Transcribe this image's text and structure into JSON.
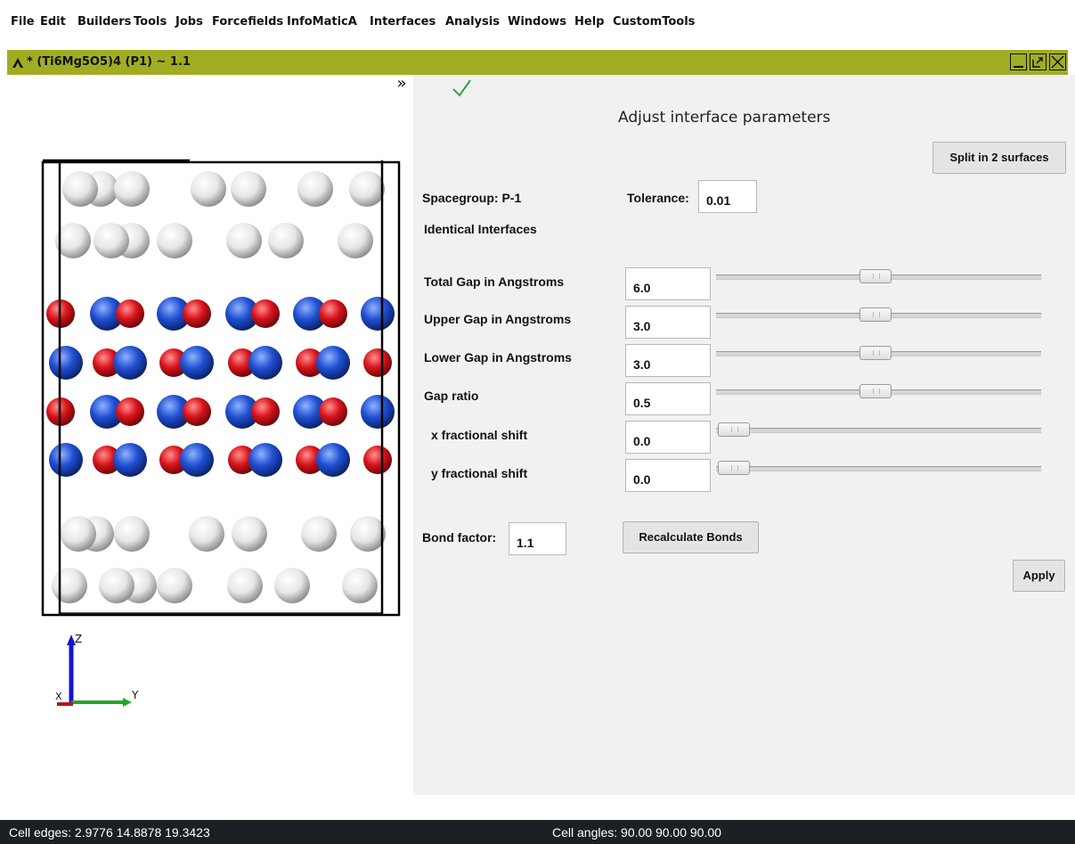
{
  "menu": [
    "File",
    "Edit",
    "Builders",
    "Tools",
    "Jobs",
    "Forcefields",
    "InfoMaticA",
    "Interfaces",
    "Analysis",
    "Windows",
    "Help",
    "CustomTools"
  ],
  "window": {
    "title": "* (Ti6Mg5O5)4  (P1) ~ 1.1",
    "icon": "app-logo-icon",
    "titlebar_color": "#a0ad23",
    "buttons": [
      "minimize-icon",
      "restore-icon",
      "close-icon"
    ]
  },
  "viewer": {
    "collapse_glyph": "»",
    "axes": {
      "z": "Z",
      "y": "Y",
      "x": "X"
    },
    "atom_colors": {
      "white": "#e6e6e6",
      "blue": "#1f4fd1",
      "red": "#d8141c"
    }
  },
  "panel": {
    "status_icon": "check-icon",
    "title": "Adjust interface parameters",
    "split_button": "Split in 2 surfaces",
    "spacegroup_label": "Spacegroup: P-1",
    "tolerance_label": "Tolerance:",
    "tolerance_value": "0.01",
    "identical_label": "Identical Interfaces",
    "params": [
      {
        "label": "Total Gap in Angstroms",
        "value": "6.0",
        "slider_fraction": 0.49
      },
      {
        "label": "Upper Gap in Angstroms",
        "value": "3.0",
        "slider_fraction": 0.49
      },
      {
        "label": "Lower Gap in Angstroms",
        "value": "3.0",
        "slider_fraction": 0.49
      },
      {
        "label": "Gap ratio",
        "value": "0.5",
        "slider_fraction": 0.49
      },
      {
        "label": "x fractional shift",
        "value": "0.0",
        "slider_fraction": 0.0
      },
      {
        "label": "y fractional shift",
        "value": "0.0",
        "slider_fraction": 0.0
      }
    ],
    "bond_factor_label": "Bond factor:",
    "bond_factor_value": "1.1",
    "recalc_button": "Recalculate Bonds",
    "apply_button": "Apply"
  },
  "status": {
    "cell_edges": "Cell edges: 2.9776 14.8878 19.3423",
    "cell_angles": "Cell angles:  90.00  90.00  90.00"
  }
}
